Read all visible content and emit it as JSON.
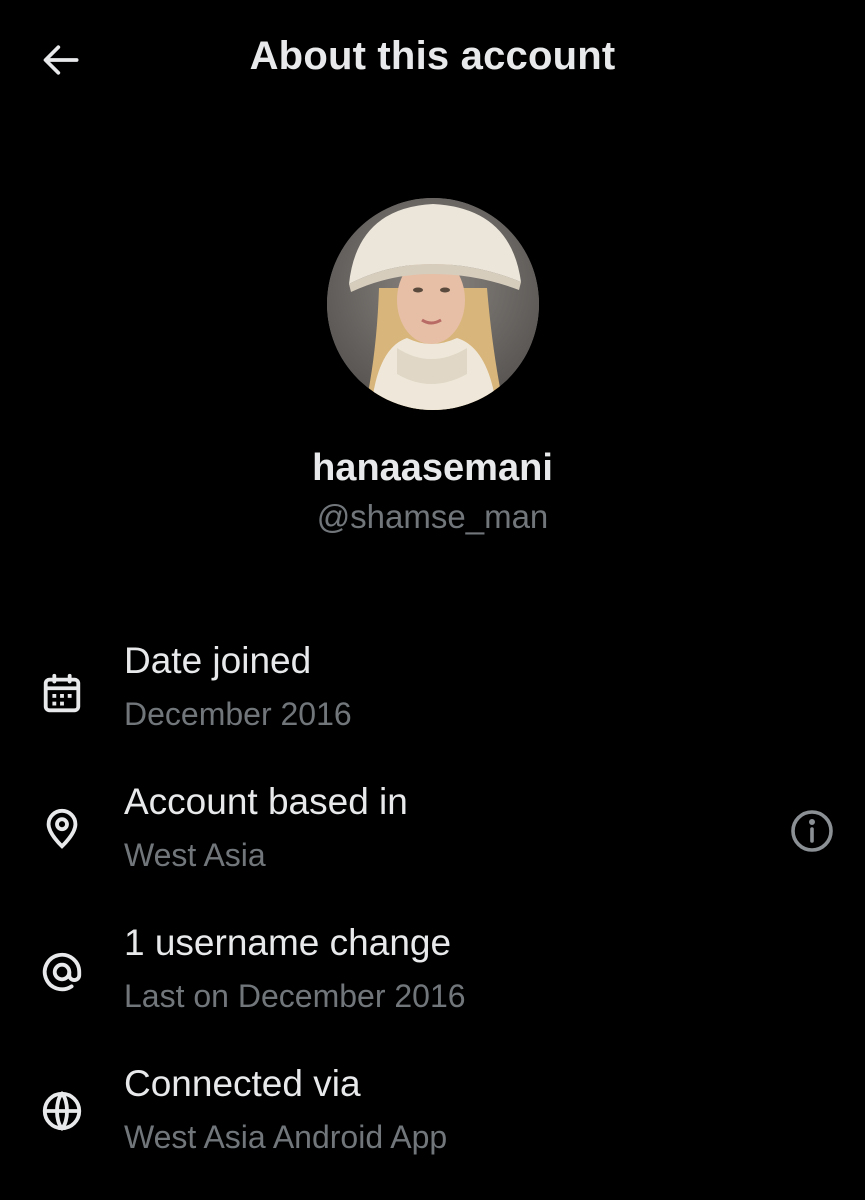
{
  "header": {
    "title": "About this account",
    "back_icon": "arrow-left-icon"
  },
  "profile": {
    "display_name": "hanaasemani",
    "handle": "@shamse_man"
  },
  "details": [
    {
      "icon": "calendar-icon",
      "label": "Date joined",
      "value": "December 2016"
    },
    {
      "icon": "location-pin-icon",
      "label": "Account based in",
      "value": "West Asia",
      "info_icon": "info-icon"
    },
    {
      "icon": "at-sign-icon",
      "label": "1 username change",
      "value": "Last on December 2016"
    },
    {
      "icon": "globe-icon",
      "label": "Connected via",
      "value": "West Asia Android App"
    }
  ],
  "colors": {
    "background": "#000000",
    "primary_text": "#e7e9ea",
    "secondary_text": "#71767b"
  }
}
